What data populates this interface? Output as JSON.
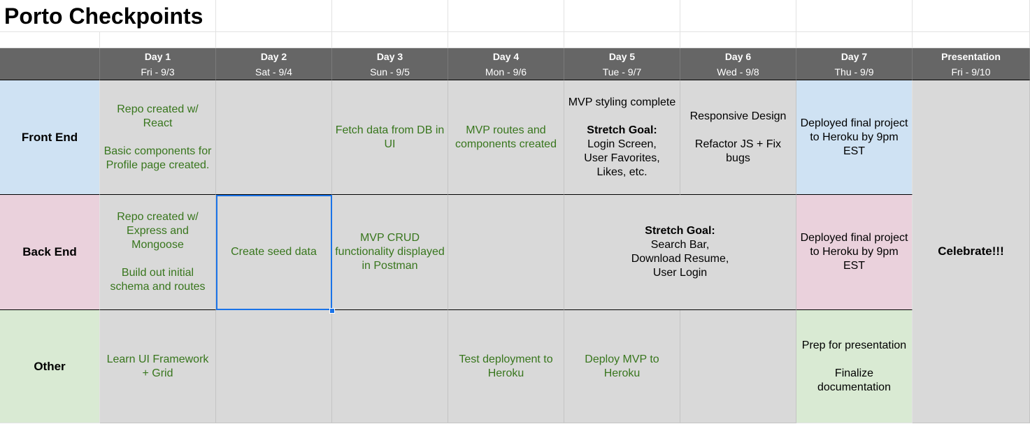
{
  "title": "Porto Checkpoints",
  "days": [
    {
      "day": "Day 1",
      "date": "Fri - 9/3"
    },
    {
      "day": "Day 2",
      "date": "Sat - 9/4"
    },
    {
      "day": "Day 3",
      "date": "Sun - 9/5"
    },
    {
      "day": "Day 4",
      "date": "Mon - 9/6"
    },
    {
      "day": "Day 5",
      "date": "Tue - 9/7"
    },
    {
      "day": "Day 6",
      "date": "Wed - 9/8"
    },
    {
      "day": "Day 7",
      "date": "Thu - 9/9"
    },
    {
      "day": "Presentation",
      "date": "Fri - 9/10"
    }
  ],
  "rows": {
    "front_end": {
      "label": "Front End",
      "day1": "Repo created w/\nReact\n\nBasic components for\nProfile page created.",
      "day3": "Fetch data from DB in\nUI",
      "day4": "MVP routes and\ncomponents created",
      "day5_a": "MVP styling complete",
      "day5_b": "Stretch Goal:",
      "day5_c": "Login Screen,\nUser Favorites,\nLikes, etc.",
      "day6": "Responsive Design\n\nRefactor JS + Fix\nbugs",
      "day7": "Deployed final project\nto Heroku by 9pm\nEST"
    },
    "back_end": {
      "label": "Back End",
      "day1": "Repo created w/\nExpress and\nMongoose\n\nBuild out initial\nschema and routes",
      "day2": "Create seed data",
      "day3": "MVP CRUD\nfunctionality displayed\nin Postman",
      "day56_a": "Stretch Goal:",
      "day56_b": "Search Bar,\nDownload Resume,\nUser Login",
      "day7": "Deployed final project\nto Heroku by 9pm\nEST"
    },
    "other": {
      "label": "Other",
      "day1": "Learn UI Framework\n+ Grid",
      "day4": "Test deployment to\nHeroku",
      "day5": "Deploy MVP to\nHeroku",
      "day7": "Prep for presentation\n\nFinalize\ndocumentation"
    }
  },
  "presentation_cell": "Celebrate!!!",
  "colors": {
    "header_bg": "#666666",
    "cell_gray": "#d9d9d9",
    "front_end": "#cfe2f3",
    "back_end": "#ead1dc",
    "other": "#d9ead3",
    "green_text": "#38761d",
    "selection": "#1a73e8"
  }
}
